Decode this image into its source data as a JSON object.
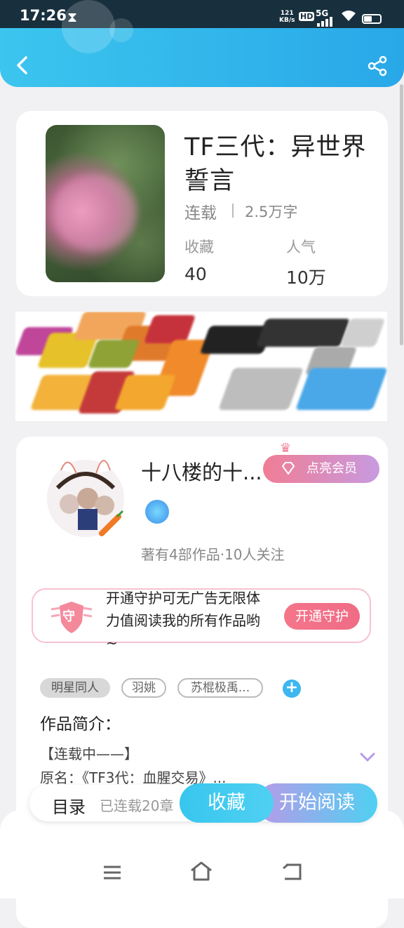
{
  "status_bar": {
    "time": "17:26",
    "speed_value": "121",
    "speed_unit": "KB/s",
    "hd": "HD",
    "network": "5G"
  },
  "header": {
    "back_icon": "chevron-left-icon",
    "share_icon": "share-icon",
    "bg_color": "#33b8ec"
  },
  "book": {
    "title": "TF三代：异世界誓言",
    "status": "连载",
    "word_count": "2.5万字",
    "favorites_label": "收藏",
    "favorites_value": "40",
    "popularity_label": "人气",
    "popularity_value": "10万"
  },
  "author": {
    "name": "十八楼的十...",
    "vip_button": "点亮会员",
    "stats": "著有4部作品·10人关注"
  },
  "guard": {
    "text": "开通守护可无广告无限体力值阅读我的所有作品哟~",
    "shield_char": "守",
    "button": "开通守护"
  },
  "tags": [
    "明星同人",
    "羽姚",
    "苏棍极禹..."
  ],
  "intro": {
    "heading": "作品简介：",
    "line1": "【连载中——】",
    "line2": "原名：《TF3代：血腥交易》..."
  },
  "action_bar": {
    "catalog": "目录",
    "chapters": "已连载20章",
    "collect": "收藏",
    "read": "开始阅读"
  },
  "colors": {
    "accent_blue": "#3cc5ee",
    "vip_pink": "#f07d94",
    "guard_red": "#ef6c86"
  }
}
